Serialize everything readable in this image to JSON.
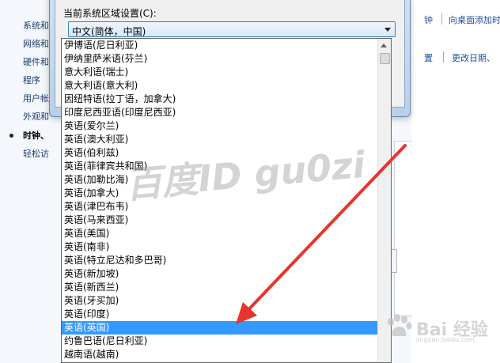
{
  "background": {
    "nav_items": [
      "系统和",
      "网络和",
      "硬件和",
      "程序",
      "用户帐",
      "外观和",
      "时钟、",
      "轻松访"
    ],
    "active_nav_index": 6,
    "links": {
      "top_right_left": "钟",
      "top_right": "向桌面添加时",
      "mid_right_left": "置",
      "mid_right": "更改日期、"
    }
  },
  "dialog": {
    "region_label": "当前系统区域设置(C):",
    "selected_value": "中文(简体，中国)"
  },
  "dropdown": {
    "items": [
      "伊博语(尼日利亚)",
      "伊纳里萨米语(芬兰)",
      "意大利语(瑞士)",
      "意大利语(意大利)",
      "因纽特语(拉丁语，加拿大)",
      "印度尼西亚语(印度尼西亚)",
      "英语(爱尔兰)",
      "英语(澳大利亚)",
      "英语(伯利兹)",
      "英语(菲律宾共和国)",
      "英语(加勒比海)",
      "英语(加拿大)",
      "英语(津巴布韦)",
      "英语(马来西亚)",
      "英语(美国)",
      "英语(南非)",
      "英语(特立尼达和多巴哥)",
      "英语(新加坡)",
      "英语(新西兰)",
      "英语(牙买加)",
      "英语(印度)",
      "英语(英国)",
      "约鲁巴语(尼日利亚)",
      "越南语(越南)"
    ],
    "highlighted_index": 21
  },
  "watermark": {
    "text": "百度ID gu0zi",
    "brand": "Bai",
    "brand_cn": "经验",
    "brand_sub": "jingyan.baidu.com"
  },
  "colors": {
    "highlight": "#3399ff",
    "arrow": "#e8342c",
    "link": "#1f4ea6"
  }
}
